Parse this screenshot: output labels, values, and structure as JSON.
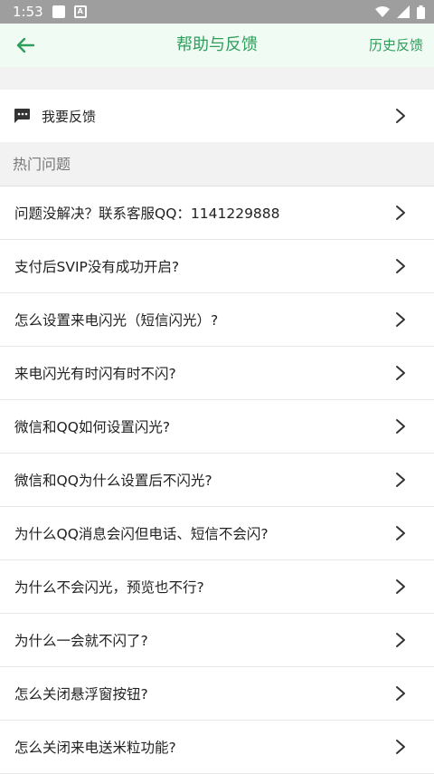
{
  "status_bar": {
    "time": "1:53",
    "a_badge": "A"
  },
  "app_bar": {
    "title": "帮助与反馈",
    "history_link": "历史反馈",
    "back_icon": "back-arrow-icon"
  },
  "feedback": {
    "label": "我要反馈",
    "icon": "chat-bubble-icon"
  },
  "section": {
    "title": "热门问题"
  },
  "faq": [
    {
      "label": "问题没解决？联系客服QQ：1141229888"
    },
    {
      "label": "支付后SVIP没有成功开启?"
    },
    {
      "label": "怎么设置来电闪光（短信闪光）?"
    },
    {
      "label": "来电闪光有时闪有时不闪?"
    },
    {
      "label": "微信和QQ如何设置闪光?"
    },
    {
      "label": "微信和QQ为什么设置后不闪光?"
    },
    {
      "label": "为什么QQ消息会闪但电话、短信不会闪?"
    },
    {
      "label": "为什么不会闪光，预览也不行?"
    },
    {
      "label": "为什么一会就不闪了?"
    },
    {
      "label": "怎么关闭悬浮窗按钮?"
    },
    {
      "label": "怎么关闭来电送米粒功能?"
    }
  ],
  "colors": {
    "accent": "#2e9e5b",
    "app_bar_bg": "#f0fbf4",
    "status_bar_bg": "#9e9e9e"
  }
}
